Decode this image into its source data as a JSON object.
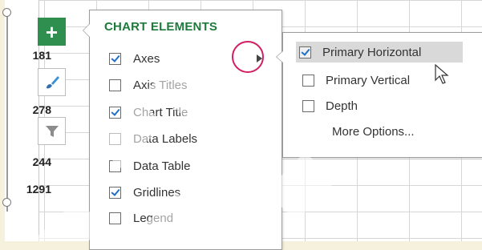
{
  "spreadsheet": {
    "values": [
      "181",
      "278",
      "244",
      "1291"
    ]
  },
  "side_buttons": {
    "chart_elements_icon": "plus-icon",
    "chart_styles_icon": "paintbrush-icon",
    "chart_filters_icon": "funnel-icon"
  },
  "chart_elements": {
    "title": "CHART ELEMENTS",
    "items": [
      {
        "label": "Axes",
        "checked": true
      },
      {
        "label": "Axis Titles",
        "checked": false
      },
      {
        "label": "Chart Title",
        "checked": true
      },
      {
        "label": "Data Labels",
        "checked": false
      },
      {
        "label": "Data Table",
        "checked": false
      },
      {
        "label": "Gridlines",
        "checked": true
      },
      {
        "label": "Legend",
        "checked": false
      }
    ]
  },
  "axes_submenu": {
    "items": [
      {
        "label": "Primary Horizontal",
        "checked": true
      },
      {
        "label": "Primary Vertical",
        "checked": false
      },
      {
        "label": "Depth",
        "checked": false
      }
    ],
    "more_options": "More Options..."
  },
  "colors": {
    "accent_green": "#2f8f4e",
    "title_green": "#1e7a3c",
    "callout_ring": "#d21e63",
    "check_blue": "#1f6fc6"
  }
}
